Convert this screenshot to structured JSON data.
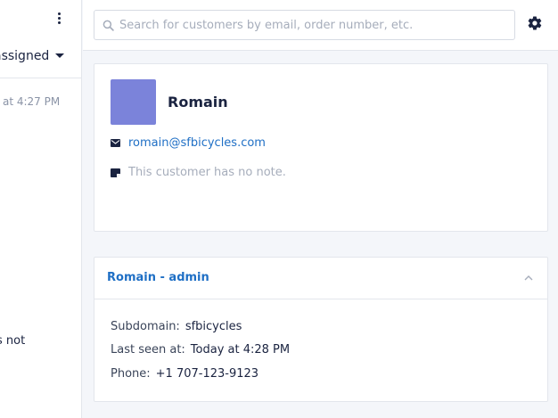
{
  "left_panel": {
    "assigned_label": "assigned",
    "timestamp": "at 4:27 PM",
    "cut_text": "s not"
  },
  "search": {
    "placeholder": "Search for customers by email, order number, etc.",
    "value": ""
  },
  "customer": {
    "name": "Romain",
    "email": "romain@sfbicycles.com",
    "note_placeholder": "This customer has no note.",
    "avatar_color": "#7b83da"
  },
  "integration": {
    "title": "Romain - admin",
    "fields": [
      {
        "label": "Subdomain:",
        "value": "sfbicycles"
      },
      {
        "label": "Last seen at:",
        "value": "Today at 4:28 PM"
      },
      {
        "label": "Phone:",
        "value": "+1 707-123-9123"
      }
    ]
  },
  "icons": {
    "search": "search-icon",
    "settings": "gear-icon",
    "menu": "kebab-menu-icon",
    "email": "mail-icon",
    "note": "note-icon",
    "collapse": "chevron-up-icon",
    "dropdown": "caret-down-icon"
  },
  "colors": {
    "link": "#1f6fc5",
    "text": "#1a2340",
    "muted": "#a6adbb"
  }
}
